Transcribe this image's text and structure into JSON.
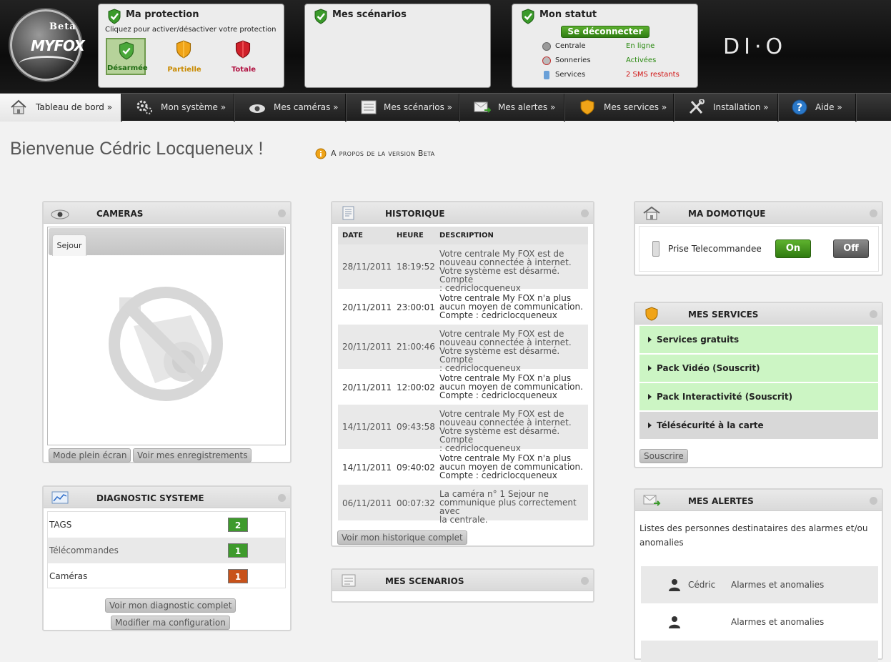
{
  "logo": {
    "beta": "Beta",
    "brand": "MYFOX"
  },
  "protection": {
    "title": "Ma protection",
    "subtitle": "Cliquez pour activer/désactiver votre protection",
    "modes": [
      {
        "label": "Désarmée",
        "color": "#2e7d22",
        "state": "selected"
      },
      {
        "label": "Partielle",
        "color": "#e6a400"
      },
      {
        "label": "Totale",
        "color": "#c4121a"
      }
    ]
  },
  "scenarios_panel": {
    "title": "Mes scénarios"
  },
  "status": {
    "title": "Mon statut",
    "logout_label": "Se déconnecter",
    "items": [
      {
        "label": "Centrale",
        "value": "En ligne",
        "value_color": "#2a8a10"
      },
      {
        "label": "Sonneries",
        "value": "Activées",
        "value_color": "#2a8a10"
      },
      {
        "label": "Services",
        "value": "2 SMS restants",
        "value_color": "#d01010"
      }
    ]
  },
  "partner_logo": "DI·O",
  "nav": [
    {
      "label": "Tableau de bord »",
      "icon": "home-icon",
      "active": true
    },
    {
      "label": "Mon système »",
      "icon": "gears-icon"
    },
    {
      "label": "Mes caméras »",
      "icon": "camera-icon"
    },
    {
      "label": "Mes scénarios »",
      "icon": "calendar-icon"
    },
    {
      "label": "Mes alertes »",
      "icon": "mail-icon"
    },
    {
      "label": "Mes services »",
      "icon": "shield-icon"
    },
    {
      "label": "Installation »",
      "icon": "tools-icon"
    },
    {
      "label": "Aide »",
      "icon": "help-icon"
    }
  ],
  "welcome": "Bienvenue Cédric Locqueneux !",
  "beta_link": "A propos de la version Beta",
  "cameras": {
    "title": "CAMERAS",
    "tab": "Sejour",
    "fullscreen_label": "Mode plein écran",
    "recordings_label": "Voir mes enregistrements"
  },
  "diagnostic": {
    "title": "DIAGNOSTIC SYSTEME",
    "rows": [
      {
        "label": "TAGS",
        "count": "2",
        "color": "#3e9a2c"
      },
      {
        "label": "Télécommandes",
        "count": "1",
        "color": "#3e9a2c"
      },
      {
        "label": "Caméras",
        "count": "1",
        "color": "#c8521a"
      }
    ],
    "full_label": "Voir mon diagnostic complet",
    "config_label": "Modifier ma configuration"
  },
  "historique": {
    "title": "HISTORIQUE",
    "columns": [
      "DATE",
      "HEURE",
      "DESCRIPTION"
    ],
    "rows": [
      {
        "date": "28/11/2011",
        "time": "18:19:52",
        "desc": [
          "Votre centrale My FOX est de",
          "nouveau connectée à internet.",
          "Votre système est désarmé. Compte",
          ": cedriclocqueneux"
        ]
      },
      {
        "date": "20/11/2011",
        "time": "23:00:01",
        "desc": [
          "Votre centrale My FOX n'a plus",
          "aucun moyen de communication.",
          "Compte : cedriclocqueneux"
        ]
      },
      {
        "date": "20/11/2011",
        "time": "21:00:46",
        "desc": [
          "Votre centrale My FOX est de",
          "nouveau connectée à internet.",
          "Votre système est désarmé. Compte",
          ": cedriclocqueneux"
        ]
      },
      {
        "date": "20/11/2011",
        "time": "12:00:02",
        "desc": [
          "Votre centrale My FOX n'a plus",
          "aucun moyen de communication.",
          "Compte : cedriclocqueneux"
        ]
      },
      {
        "date": "14/11/2011",
        "time": "09:43:58",
        "desc": [
          "Votre centrale My FOX est de",
          "nouveau connectée à internet.",
          "Votre système est désarmé. Compte",
          ": cedriclocqueneux"
        ]
      },
      {
        "date": "14/11/2011",
        "time": "09:40:02",
        "desc": [
          "Votre centrale My FOX n'a plus",
          "aucun moyen de communication.",
          "Compte : cedriclocqueneux"
        ]
      },
      {
        "date": "06/11/2011",
        "time": "00:07:32",
        "desc": [
          "La caméra n° 1 Sejour ne",
          "communique plus correctement avec",
          "la centrale."
        ]
      }
    ],
    "full_label": "Voir mon historique complet"
  },
  "mes_scenarios": {
    "title": "MES SCENARIOS"
  },
  "domotique": {
    "title": "MA DOMOTIQUE",
    "device": "Prise Telecommandee",
    "on_label": "On",
    "off_label": "Off"
  },
  "services": {
    "title": "MES SERVICES",
    "items": [
      "Services gratuits",
      "Pack Vidéo (Souscrit)",
      "Pack Interactivité (Souscrit)",
      "Télésécurité à la carte"
    ],
    "subscribe_label": "Souscrire"
  },
  "alertes": {
    "title": "MES ALERTES",
    "description": [
      "Listes des personnes destinataires des alarmes et/ou",
      "anomalies"
    ],
    "people": [
      {
        "name": "Cédric",
        "type": "Alarmes et anomalies"
      },
      {
        "name": "",
        "type": "Alarmes et anomalies"
      }
    ]
  }
}
